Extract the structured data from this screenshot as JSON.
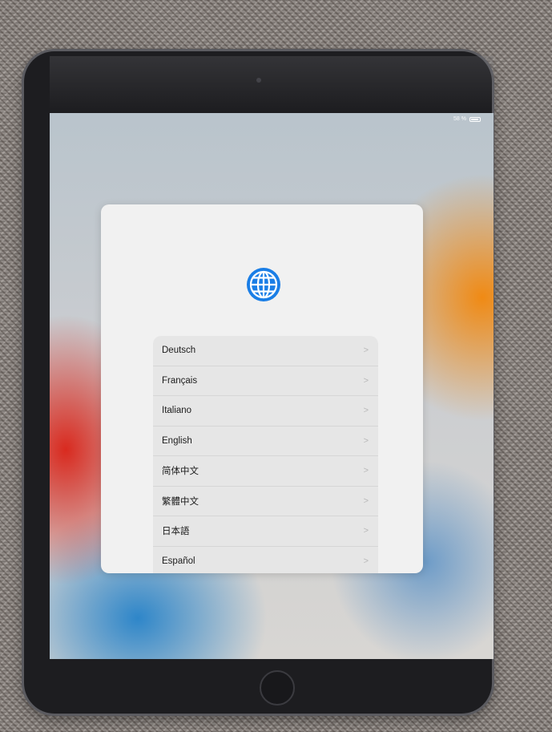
{
  "status_bar": {
    "battery_text": "58 %",
    "battery_icon": "battery-icon"
  },
  "setup": {
    "icon": "globe-icon",
    "accent_color": "#1a7ee6",
    "languages": [
      {
        "label": "Deutsch"
      },
      {
        "label": "Français"
      },
      {
        "label": "Italiano"
      },
      {
        "label": "English"
      },
      {
        "label": "简体中文"
      },
      {
        "label": "繁體中文"
      },
      {
        "label": "日本語"
      },
      {
        "label": "Español"
      }
    ],
    "row_chevron": "chevron-right-icon"
  }
}
